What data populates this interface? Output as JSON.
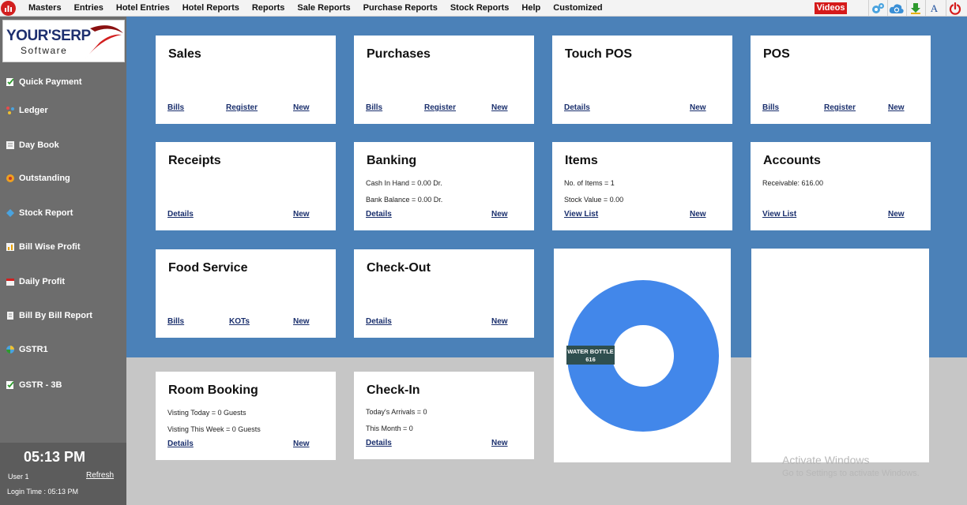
{
  "menubar": {
    "items": [
      "Masters",
      "Entries",
      "Hotel Entries",
      "Hotel Reports",
      "Reports",
      "Sale Reports",
      "Purchase Reports",
      "Stock Reports",
      "Help",
      "Customized"
    ],
    "videos_label": "Videos",
    "toolbar_icons": [
      "settings-gears-icon",
      "cloud-sync-icon",
      "download-icon",
      "font-icon",
      "power-icon"
    ],
    "font_label": "A"
  },
  "logo": {
    "main": "YOUR'SERP",
    "sub": "Software"
  },
  "sidebar": {
    "items": [
      {
        "label": "Quick Payment",
        "icon": "quick-payment-icon"
      },
      {
        "label": "Ledger",
        "icon": "ledger-icon"
      },
      {
        "label": "Day Book",
        "icon": "day-book-icon"
      },
      {
        "label": "Outstanding",
        "icon": "outstanding-icon"
      },
      {
        "label": "Stock Report",
        "icon": "stock-report-icon"
      },
      {
        "label": "Bill Wise Profit",
        "icon": "bill-wise-profit-icon"
      },
      {
        "label": "Daily Profit",
        "icon": "daily-profit-icon"
      },
      {
        "label": "Bill By Bill Report",
        "icon": "bill-by-bill-icon"
      },
      {
        "label": "GSTR1",
        "icon": "gstr1-icon"
      },
      {
        "label": "GSTR - 3B",
        "icon": "gstr3b-icon"
      }
    ],
    "clock": "05:13 PM",
    "user": "User 1",
    "refresh": "Refresh",
    "login_time": "Login Time : 05:13 PM"
  },
  "cards": {
    "sales": {
      "title": "Sales",
      "links": [
        "Bills",
        "Register",
        "New"
      ]
    },
    "purchases": {
      "title": "Purchases",
      "links": [
        "Bills",
        "Register",
        "New"
      ]
    },
    "touch_pos": {
      "title": "Touch POS",
      "links": [
        "Details",
        "New"
      ]
    },
    "pos": {
      "title": "POS",
      "links": [
        "Bills",
        "Register",
        "New"
      ]
    },
    "receipts": {
      "title": "Receipts",
      "links": [
        "Details",
        "New"
      ]
    },
    "banking": {
      "title": "Banking",
      "lines": [
        "Cash In Hand = 0.00 Dr.",
        "Bank Balance = 0.00 Dr."
      ],
      "links": [
        "Details",
        "New"
      ]
    },
    "items": {
      "title": "Items",
      "lines": [
        "No. of Items = 1",
        "Stock Value = 0.00"
      ],
      "links": [
        "View List",
        "New"
      ]
    },
    "accounts": {
      "title": "Accounts",
      "lines": [
        "Receivable: 616.00"
      ],
      "links": [
        "View List",
        "New"
      ]
    },
    "food_service": {
      "title": "Food Service",
      "links": [
        "Bills",
        "KOTs",
        "New"
      ]
    },
    "check_out": {
      "title": "Check-Out",
      "links": [
        "Details",
        "New"
      ]
    },
    "room_booking": {
      "title": "Room Booking",
      "lines": [
        "Visting Today = 0 Guests",
        "Visting This Week = 0 Guests"
      ],
      "links": [
        "Details",
        "New"
      ]
    },
    "check_in": {
      "title": "Check-In",
      "lines": [
        "Today's Arrivals = 0",
        "This Month = 0"
      ],
      "links": [
        "Details",
        "New"
      ]
    }
  },
  "chart_data": {
    "type": "pie",
    "variant": "donut",
    "categories": [
      "WATER BOTTLE"
    ],
    "values": [
      616
    ],
    "colors": [
      "#4287ea"
    ],
    "data_labels": [
      {
        "category": "WATER BOTTLE",
        "value": "616"
      }
    ]
  },
  "watermark": {
    "line1": "Activate Windows",
    "line2": "Go to Settings to activate Windows."
  },
  "colors": {
    "header_blue": "#4b81b8",
    "sidebar_gray": "#6d6d6d",
    "link": "#1a2f6d",
    "videos_red": "#d51a1a",
    "donut_blue": "#4287ea"
  }
}
